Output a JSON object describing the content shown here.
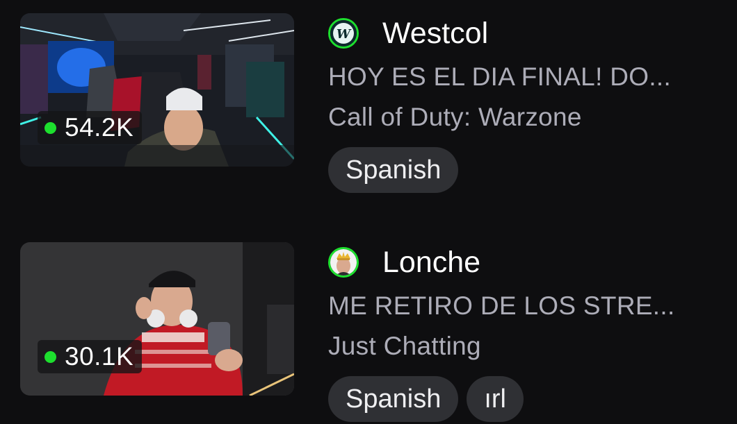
{
  "streams": [
    {
      "channel": "Westcol",
      "viewers": "54.2K",
      "title": "HOY ES EL DIA FINAL! DO...",
      "category": "Call of Duty: Warzone",
      "tags": [
        "Spanish"
      ]
    },
    {
      "channel": "Lonche",
      "viewers": "30.1K",
      "title": "ME RETIRO DE LOS STRE...",
      "category": "Just Chatting",
      "tags": [
        "Spanish",
        "ırl"
      ]
    }
  ],
  "colors": {
    "live": "#1ddf2e",
    "background": "#0e0e10",
    "muted_text": "#adadb8",
    "tag_bg": "#2f3034"
  }
}
